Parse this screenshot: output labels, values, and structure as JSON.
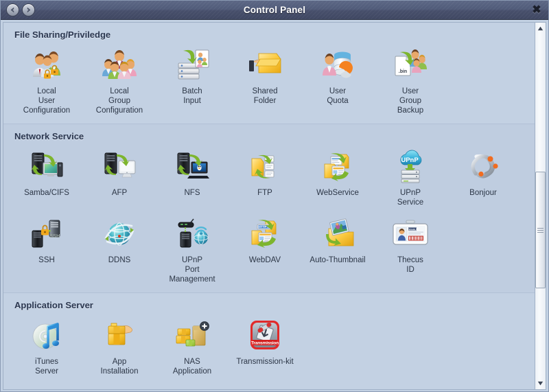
{
  "window": {
    "title": "Control Panel",
    "back_icon": "back-arrow-icon",
    "forward_icon": "forward-arrow-icon",
    "close_label": "✖"
  },
  "scrollbar": {
    "up_arrow": "scroll-up-arrow-icon",
    "down_arrow": "scroll-down-arrow-icon"
  },
  "colors": {
    "titlebar": "#4b5470",
    "content_bg": "#c3d1e3",
    "section_alt_bg": "#bfcde0",
    "label_text": "#2c3646",
    "heading_text": "#2b3750"
  },
  "sections": [
    {
      "title": "File Sharing/Priviledge",
      "items": [
        {
          "label": "Local\nUser\nConfiguration",
          "icon": "local-user-configuration-icon"
        },
        {
          "label": "Local\nGroup\nConfiguration",
          "icon": "local-group-configuration-icon"
        },
        {
          "label": "Batch\nInput",
          "icon": "batch-input-icon"
        },
        {
          "label": "Shared\nFolder",
          "icon": "shared-folder-icon"
        },
        {
          "label": "User\nQuota",
          "icon": "user-quota-icon"
        },
        {
          "label": "User\nGroup\nBackup",
          "icon": "user-group-backup-icon"
        }
      ]
    },
    {
      "title": "Network Service",
      "items": [
        {
          "label": "Samba/CIFS",
          "icon": "samba-cifs-icon"
        },
        {
          "label": "AFP",
          "icon": "afp-icon"
        },
        {
          "label": "NFS",
          "icon": "nfs-icon"
        },
        {
          "label": "FTP",
          "icon": "ftp-icon"
        },
        {
          "label": "WebService",
          "icon": "webservice-icon"
        },
        {
          "label": "UPnP\nService",
          "icon": "upnp-service-icon"
        },
        {
          "label": "Bonjour",
          "icon": "bonjour-icon"
        },
        {
          "label": "SSH",
          "icon": "ssh-icon"
        },
        {
          "label": "DDNS",
          "icon": "ddns-icon"
        },
        {
          "label": "UPnP\nPort\nManagement",
          "icon": "upnp-port-management-icon"
        },
        {
          "label": "WebDAV",
          "icon": "webdav-icon"
        },
        {
          "label": "Auto-Thumbnail",
          "icon": "auto-thumbnail-icon"
        },
        {
          "label": "Thecus\nID",
          "icon": "thecus-id-icon"
        }
      ]
    },
    {
      "title": "Application Server",
      "items": [
        {
          "label": "iTunes\nServer",
          "icon": "itunes-server-icon"
        },
        {
          "label": "App\nInstallation",
          "icon": "app-installation-icon"
        },
        {
          "label": "NAS\nApplication",
          "icon": "nas-application-icon"
        },
        {
          "label": "Transmission-kit",
          "icon": "transmission-kit-icon"
        }
      ]
    }
  ]
}
